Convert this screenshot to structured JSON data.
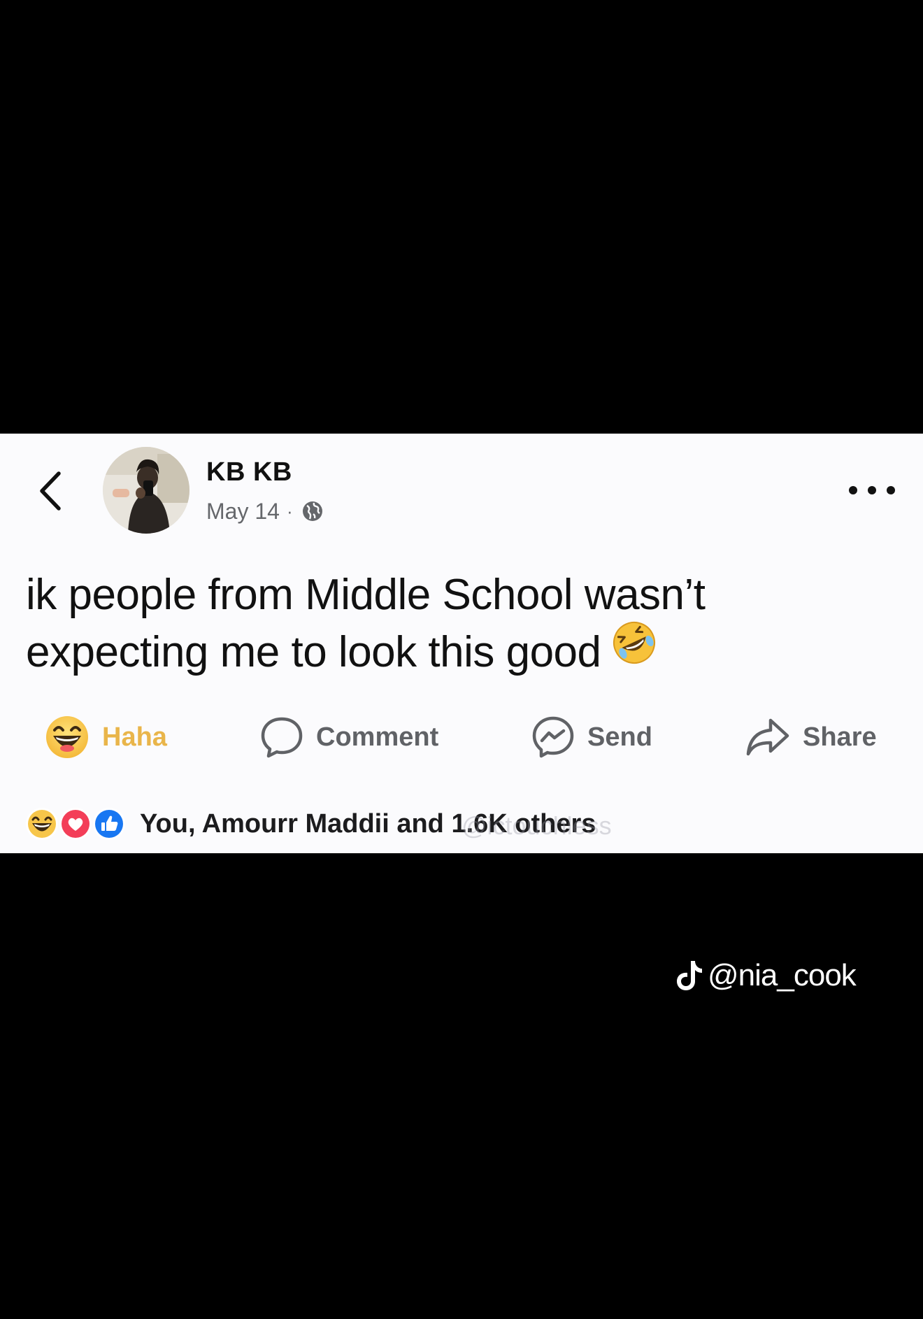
{
  "post": {
    "author_name": "KB KB",
    "date": "May 14",
    "dot": "·",
    "text_line1": "ik people from Middle School wasn’t",
    "text_line2": "expecting me to look this good"
  },
  "actions": {
    "haha_label": "Haha",
    "comment_label": "Comment",
    "send_label": "Send",
    "share_label": "Share"
  },
  "reactions": {
    "summary": "You, Amourr Maddii and 1.6K others",
    "faint_watermark": "@ictouchless"
  },
  "overlay": {
    "tiktok_handle": "@nia_cook"
  },
  "colors": {
    "card_bg": "#fbfbfd",
    "haha_yellow": "#e9b54a",
    "like_blue": "#1877f2",
    "love_red": "#f33e58"
  },
  "icons": {
    "back": "chevron-left-icon",
    "globe": "globe-icon",
    "more": "more-horizontal-icon",
    "haha": "haha-emoji-icon",
    "comment": "comment-bubble-icon",
    "send": "messenger-icon",
    "share": "share-arrow-icon",
    "laugh_inline": "rofl-emoji-icon",
    "tiktok": "tiktok-logo-icon"
  }
}
